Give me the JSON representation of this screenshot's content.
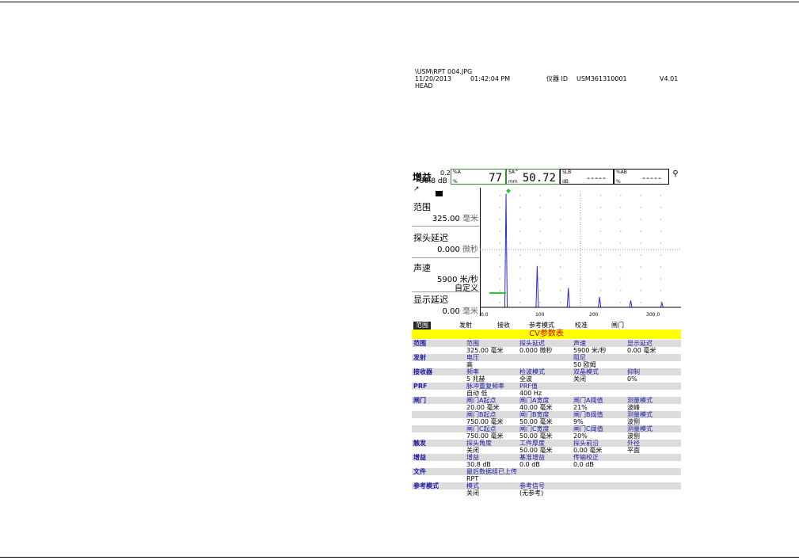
{
  "file_path": "\\USM\\RPT 004.JPG",
  "date": "11/20/2013",
  "time": "01:42:04 PM",
  "instrument_label": "仪器 ID",
  "instrument_id": "USM361310001",
  "version": "V4.01",
  "head_label": "HEAD",
  "readout": {
    "gain_label": "增益",
    "gain_step": "0.2",
    "gain_value": "30.8 dB",
    "box1": {
      "label": "%A",
      "unit": "%",
      "value": "77"
    },
    "box2": {
      "label": "SA^",
      "unit": "mm",
      "value": "50.72"
    },
    "box3": {
      "label": "SLB",
      "unit": "dB",
      "value": "-----"
    },
    "box4": {
      "label": "%AB",
      "unit": "%",
      "value": "-----"
    }
  },
  "left_panel": {
    "range_label": "范围",
    "range_value": "325.00",
    "range_unit": "毫米",
    "probe_delay_label": "探头延迟",
    "probe_delay_value": "0.000",
    "probe_delay_unit": "微秒",
    "velocity_label": "声速",
    "velocity_value": "5900 米/秒",
    "velocity_mode": "自定义",
    "display_delay_label": "显示延迟",
    "display_delay_value": "0.00",
    "display_delay_unit": "毫米"
  },
  "ascan": {
    "x_ticks": [
      "0.0",
      "100",
      "200",
      "300.0"
    ]
  },
  "ascan_echoes": [
    {
      "pos": 0.13,
      "amp": 0.99
    },
    {
      "pos": 0.285,
      "amp": 0.36
    },
    {
      "pos": 0.44,
      "amp": 0.17
    },
    {
      "pos": 0.595,
      "amp": 0.09
    },
    {
      "pos": 0.75,
      "amp": 0.06
    },
    {
      "pos": 0.905,
      "amp": 0.04
    }
  ],
  "tabs": [
    "范围",
    "发射",
    "接收",
    "参考模式",
    "校准",
    "闸门"
  ],
  "table_title": "CV参数表",
  "table": [
    {
      "shade": true,
      "cells": [
        "范围",
        "范围",
        "探头延迟",
        "声速",
        "显示延迟"
      ]
    },
    {
      "shade": false,
      "cells": [
        "",
        "325.00 毫米",
        "0.000 微秒",
        "5900 米/秒",
        "0.00 毫米"
      ]
    },
    {
      "shade": true,
      "cells": [
        "发射",
        "电压",
        "",
        "阻尼",
        ""
      ]
    },
    {
      "shade": false,
      "cells": [
        "",
        "高",
        "",
        "50 欧姆",
        ""
      ]
    },
    {
      "shade": true,
      "cells": [
        "接收器",
        "频率",
        "检波模式",
        "双晶模式",
        "抑制"
      ]
    },
    {
      "shade": false,
      "cells": [
        "",
        "5 兆赫",
        "全波",
        "关闭",
        "0%"
      ]
    },
    {
      "shade": true,
      "cells": [
        "PRF",
        "脉冲重复频率",
        "PRF值",
        "",
        ""
      ]
    },
    {
      "shade": false,
      "cells": [
        "",
        "自动 低",
        "400 Hz",
        "",
        ""
      ]
    },
    {
      "shade": true,
      "cells": [
        "闸门",
        "闸门A起点",
        "闸门A宽度",
        "闸门A阈值",
        "测量模式"
      ]
    },
    {
      "shade": false,
      "cells": [
        "",
        "20.00 毫米",
        "40.00 毫米",
        "21%",
        "波峰"
      ]
    },
    {
      "shade": true,
      "cells": [
        "",
        "闸门B起点",
        "闸门B宽度",
        "闸门B阈值",
        "测量模式"
      ]
    },
    {
      "shade": false,
      "cells": [
        "",
        "750.00 毫米",
        "50.00 毫米",
        "9%",
        "波侧"
      ]
    },
    {
      "shade": true,
      "cells": [
        "",
        "闸门C起点",
        "闸门C宽度",
        "闸门C阈值",
        "测量模式"
      ]
    },
    {
      "shade": false,
      "cells": [
        "",
        "750.00 毫米",
        "50.00 毫米",
        "20%",
        "波侧"
      ]
    },
    {
      "shade": true,
      "cells": [
        "触发",
        "探头角度",
        "工件厚度",
        "探头前沿",
        "外径"
      ]
    },
    {
      "shade": false,
      "cells": [
        "",
        "关闭",
        "50.00 毫米",
        "0.00 毫米",
        "平面"
      ]
    },
    {
      "shade": true,
      "cells": [
        "增益",
        "增益",
        "基准增益",
        "传输校正",
        ""
      ]
    },
    {
      "shade": false,
      "cells": [
        "",
        "30.8 dB",
        "0.0 dB",
        "0.0 dB",
        ""
      ]
    },
    {
      "shade": true,
      "cells": [
        "文件",
        "最后数据组已上传",
        "",
        "",
        ""
      ]
    },
    {
      "shade": false,
      "cells": [
        "",
        "RPT",
        "",
        "",
        ""
      ]
    },
    {
      "shade": true,
      "cells": [
        "参考模式",
        "模式",
        "参考信号",
        "",
        ""
      ]
    },
    {
      "shade": false,
      "cells": [
        "",
        "关闭",
        "(无参考)",
        "",
        ""
      ]
    }
  ]
}
